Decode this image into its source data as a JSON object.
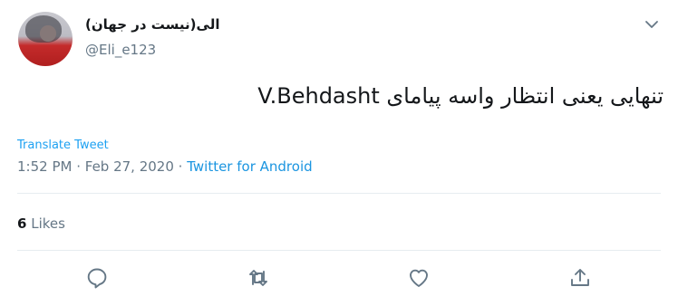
{
  "tweet": {
    "display_name": "الی(نیست در جهان)",
    "handle": "@Eli_e123",
    "text": "تنهایی یعنی انتظار واسه پیامای V.Behdasht",
    "translate_label": "Translate Tweet",
    "time": "1:52 PM",
    "separator": " · ",
    "date": "Feb 27, 2020",
    "source": "Twitter for Android",
    "likes_count": "6",
    "likes_label": "Likes"
  },
  "colors": {
    "link": "#1da1f2",
    "secondary_text": "#657786",
    "divider": "#e6ecf0"
  },
  "icons": [
    "chevron-down-icon",
    "reply-icon",
    "retweet-icon",
    "like-icon",
    "share-icon"
  ]
}
